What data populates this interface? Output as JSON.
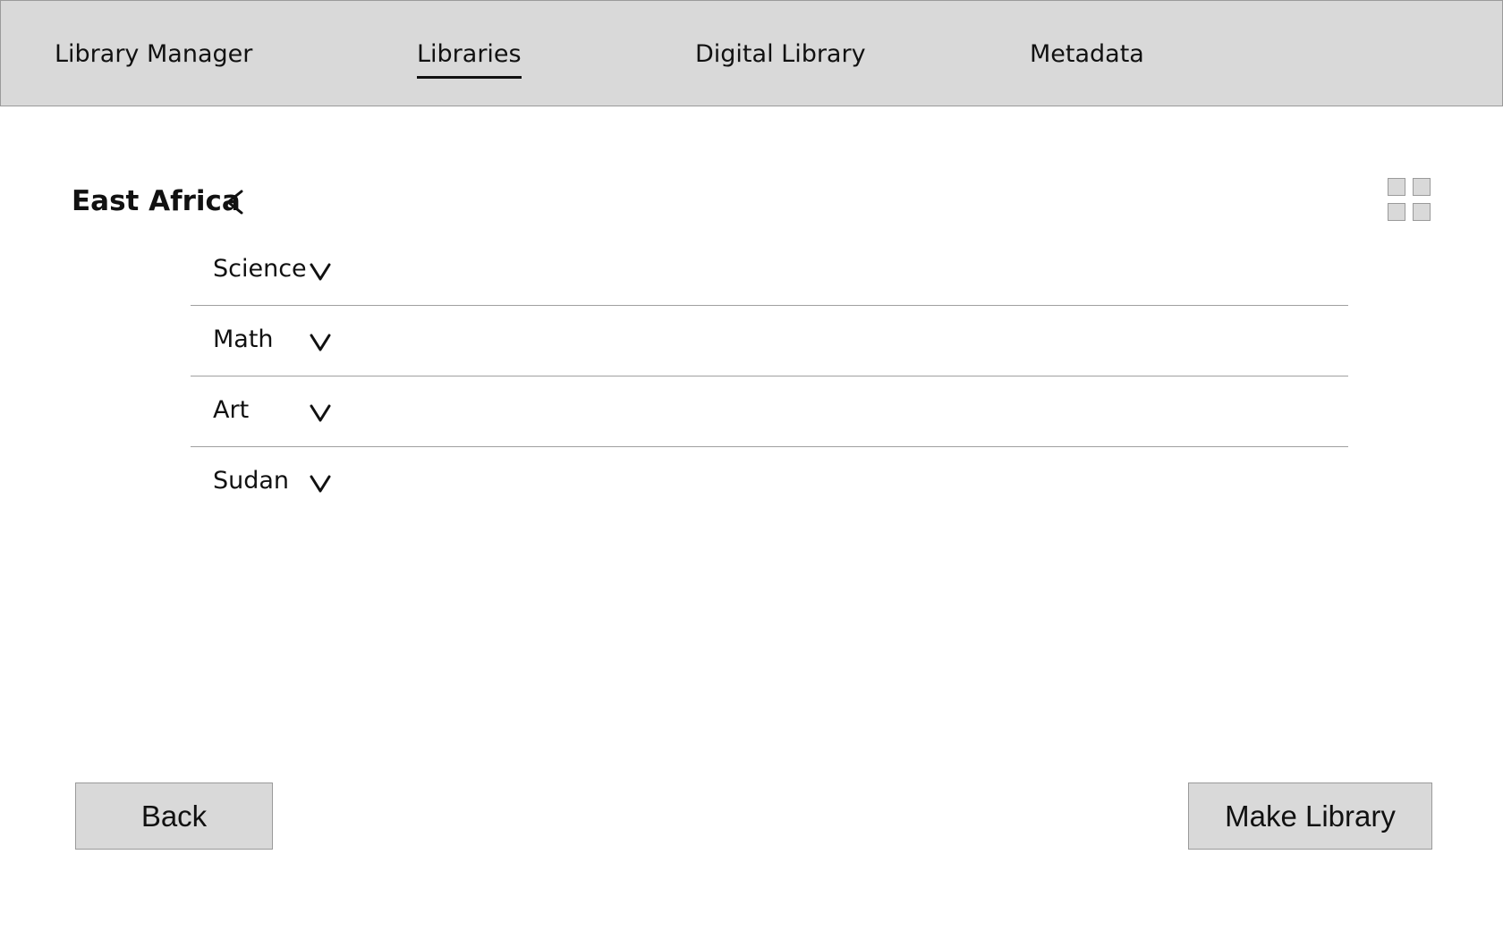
{
  "nav": {
    "items": [
      {
        "label": "Library Manager",
        "active": false
      },
      {
        "label": "Libraries",
        "active": true
      },
      {
        "label": "Digital Library",
        "active": false
      },
      {
        "label": "Metadata",
        "active": false
      }
    ]
  },
  "section": {
    "title": "East Africa",
    "toggle_icon": "chevron-left-icon"
  },
  "view_toggle": {
    "icon": "grid-view-icon"
  },
  "list": {
    "items": [
      {
        "label": "Science",
        "icon": "chevron-down-icon"
      },
      {
        "label": "Math",
        "icon": "chevron-down-icon"
      },
      {
        "label": "Art",
        "icon": "chevron-down-icon"
      },
      {
        "label": "Sudan",
        "icon": "chevron-down-icon"
      }
    ]
  },
  "actions": {
    "back_label": "Back",
    "make_library_label": "Make Library"
  },
  "colors": {
    "bar_fill": "#d9d9d9",
    "border": "#9a9a9a",
    "text": "#111111"
  }
}
